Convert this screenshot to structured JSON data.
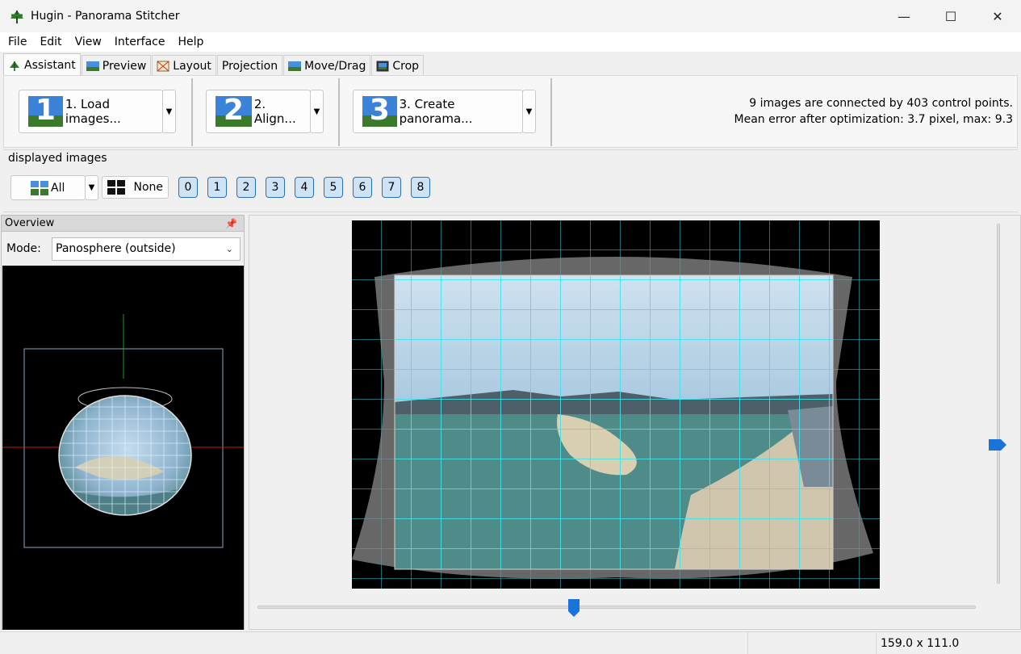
{
  "window": {
    "title": "Hugin - Panorama Stitcher",
    "app_icon": "hugin-logo-icon",
    "controls": {
      "minimize": "—",
      "maximize": "☐",
      "close": "✕"
    }
  },
  "menu": [
    "File",
    "Edit",
    "View",
    "Interface",
    "Help"
  ],
  "tabs": [
    {
      "label": "Assistant",
      "icon": "hugin-logo-icon",
      "active": true
    },
    {
      "label": "Preview",
      "icon": "landscape-icon",
      "active": false
    },
    {
      "label": "Layout",
      "icon": "layout-grid-icon",
      "active": false
    },
    {
      "label": "Projection",
      "icon": "",
      "active": false
    },
    {
      "label": "Move/Drag",
      "icon": "move-landscape-icon",
      "active": false
    },
    {
      "label": "Crop",
      "icon": "crop-frame-icon",
      "active": false
    }
  ],
  "assistant": {
    "steps": [
      {
        "number": "1",
        "label": "1. Load images..."
      },
      {
        "number": "2",
        "label": "2. Align..."
      },
      {
        "number": "3",
        "label": "3. Create panorama..."
      }
    ],
    "status_line1": "9 images are connected by 403 control points.",
    "status_line2": "Mean error after optimization: 3.7 pixel, max: 9.3"
  },
  "displayed_images": {
    "title": "displayed images",
    "all_label": "All",
    "none_label": "None",
    "images": [
      "0",
      "1",
      "2",
      "3",
      "4",
      "5",
      "6",
      "7",
      "8"
    ]
  },
  "overview": {
    "title": "Overview",
    "pin_icon": "pin-icon",
    "mode_label": "Mode:",
    "mode_value": "Panosphere (outside)"
  },
  "statusbar": {
    "size": "159.0 x 111.0"
  },
  "colors": {
    "accent": "#1a73d9",
    "grid": "#35d8e0",
    "step_sky": "#3b83d9",
    "step_ground": "#3a7a2a"
  }
}
